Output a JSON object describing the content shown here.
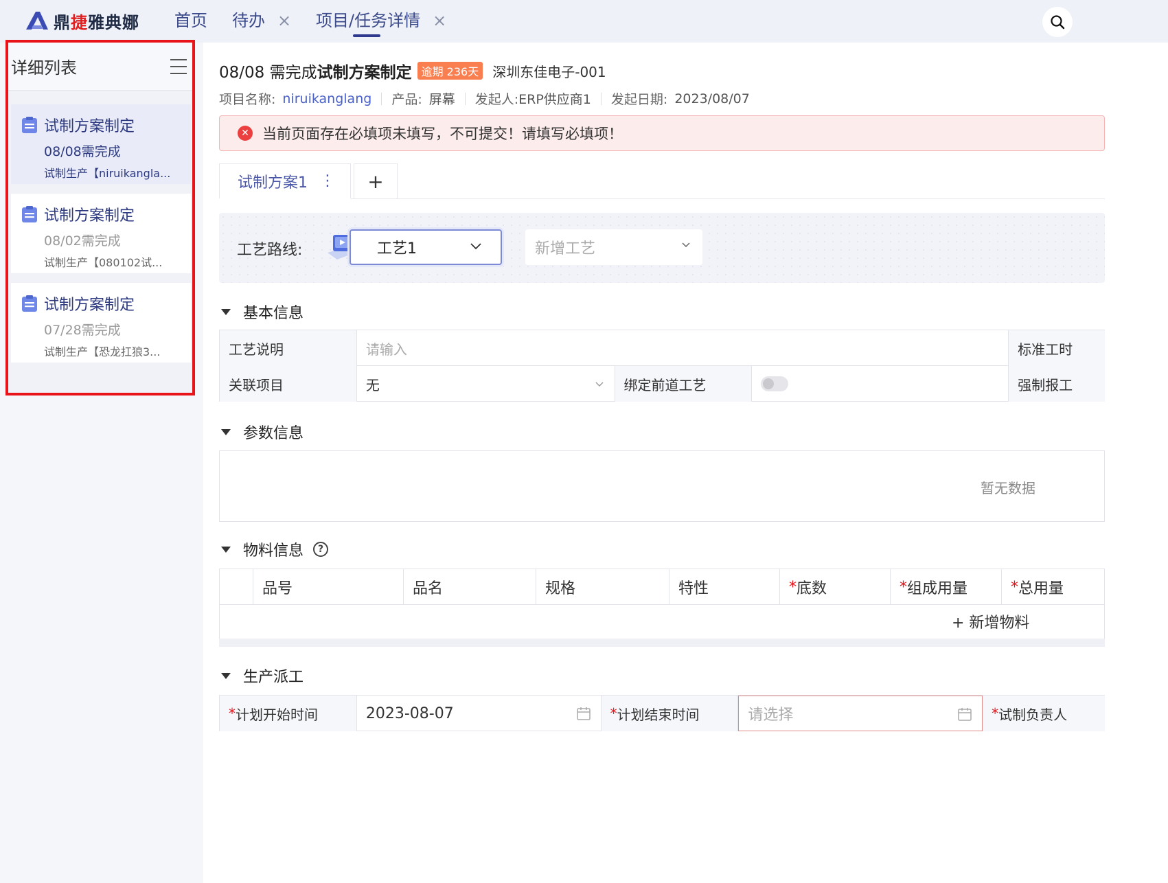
{
  "app": {
    "logo_text_a": "鼎",
    "logo_text_red": "捷",
    "logo_text_b": "雅典娜"
  },
  "nav": {
    "tabs": [
      {
        "label": "首页"
      },
      {
        "label": "待办",
        "close": "×"
      },
      {
        "label": "项目/任务详情",
        "close": "×"
      }
    ]
  },
  "sidebar": {
    "title": "详细列表",
    "items": [
      {
        "title": "试制方案制定",
        "date": "08/08需完成",
        "sub": "试制生产【niruikangla..."
      },
      {
        "title": "试制方案制定",
        "date": "08/02需完成",
        "sub": "试制生产【080102试..."
      },
      {
        "title": "试制方案制定",
        "date": "07/28需完成",
        "sub": "试制生产【恐龙扛狼3..."
      }
    ]
  },
  "header": {
    "date_prefix": "08/08 需完成",
    "task_name": "试制方案制定",
    "overdue_badge": "逾期 236天",
    "company": "深圳东佳电子-001",
    "meta": {
      "project_label": "项目名称:",
      "project_value": "niruikanglang",
      "product_label": "产品:",
      "product_value": "屏幕",
      "initiator_label": "发起人:",
      "initiator_value": "ERP供应商1",
      "date_label": "发起日期:",
      "date_value": "2023/08/07"
    },
    "alert_text": "当前页面存在必填项未填写，不可提交！请填写必填项！"
  },
  "plan_tabs": {
    "active_label": "试制方案1",
    "more": "⋮",
    "add": "+"
  },
  "route": {
    "label": "工艺路线:",
    "selected": "工艺1",
    "add_placeholder": "新增工艺"
  },
  "basic_info": {
    "title": "基本信息",
    "desc_label": "工艺说明",
    "desc_placeholder": "请输入",
    "std_time_label": "标准工时",
    "related_label": "关联项目",
    "related_value": "无",
    "bind_label": "绑定前道工艺",
    "force_label": "强制报工"
  },
  "params": {
    "title": "参数信息",
    "empty": "暂无数据"
  },
  "materials": {
    "title": "物料信息",
    "help": "?",
    "columns": [
      "品号",
      "品名",
      "规格",
      "特性",
      "底数",
      "组成用量",
      "总用量"
    ],
    "required_mark": "*",
    "add_label": "+ 新增物料"
  },
  "dispatch": {
    "title": "生产派工",
    "start_label": "计划开始时间",
    "start_value": "2023-08-07",
    "end_label": "计划结束时间",
    "end_placeholder": "请选择",
    "owner_label": "试制负责人"
  }
}
